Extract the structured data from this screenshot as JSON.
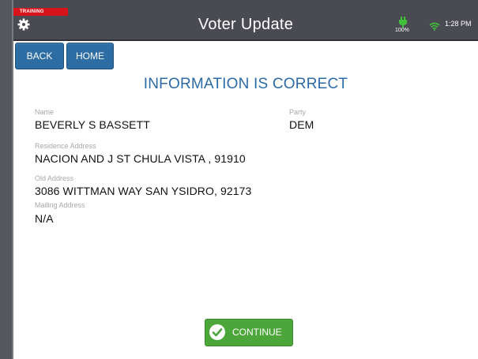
{
  "status": {
    "training_badge": "TRAINING",
    "battery_level": "100%",
    "time": "1:28 PM"
  },
  "header": {
    "title": "Voter Update",
    "settings_icon": "gear-icon",
    "battery_icon": "battery-charging-icon",
    "wifi_icon": "wifi-icon"
  },
  "nav": {
    "back_label": "BACK",
    "home_label": "HOME"
  },
  "main": {
    "heading": "INFORMATION IS CORRECT",
    "fields": {
      "name_label": "Name",
      "name_value": "BEVERLY S BASSETT",
      "party_label": "Party",
      "party_value": "DEM",
      "residence_label": "Residence Address",
      "residence_value": "NACION AND J ST CHULA VISTA , 91910",
      "old_label": "Old Address",
      "old_value": "3086 WITTMAN WAY SAN YSIDRO, 92173",
      "mailing_label": "Mailing Address",
      "mailing_value": "N/A"
    },
    "continue_label": "CONTINUE"
  },
  "colors": {
    "header_bg": "#4a4a53",
    "training_red": "#d8141b",
    "nav_button_blue": "#2e6da4",
    "heading_blue": "#2c6aa6",
    "continue_green": "#4ca63a",
    "battery_green": "#3fbf3a",
    "wifi_green": "#3fbf3a"
  }
}
